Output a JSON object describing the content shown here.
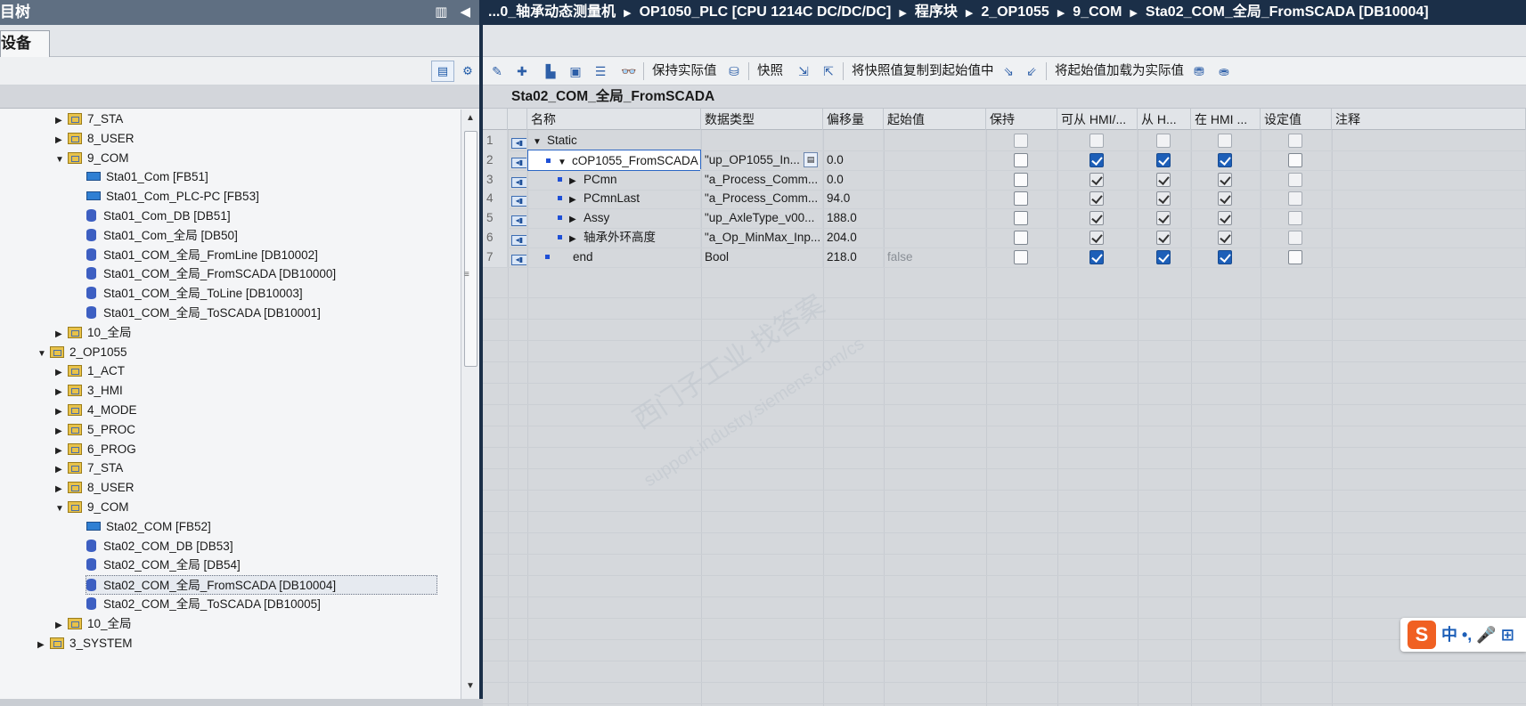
{
  "left_panel": {
    "title": "目树",
    "tab_devices": "设备",
    "tree": [
      {
        "depth": 2,
        "arrow": "right",
        "icon": "folder",
        "label": "7_STA"
      },
      {
        "depth": 2,
        "arrow": "right",
        "icon": "folder",
        "label": "8_USER"
      },
      {
        "depth": 2,
        "arrow": "down",
        "icon": "folder",
        "label": "9_COM"
      },
      {
        "depth": 3,
        "arrow": "",
        "icon": "fb",
        "label": "Sta01_Com [FB51]"
      },
      {
        "depth": 3,
        "arrow": "",
        "icon": "fb",
        "label": "Sta01_Com_PLC-PC [FB53]"
      },
      {
        "depth": 3,
        "arrow": "",
        "icon": "db",
        "label": "Sta01_Com_DB [DB51]"
      },
      {
        "depth": 3,
        "arrow": "",
        "icon": "db",
        "label": "Sta01_Com_全局 [DB50]"
      },
      {
        "depth": 3,
        "arrow": "",
        "icon": "db",
        "label": "Sta01_COM_全局_FromLine [DB10002]"
      },
      {
        "depth": 3,
        "arrow": "",
        "icon": "db",
        "label": "Sta01_COM_全局_FromSCADA [DB10000]"
      },
      {
        "depth": 3,
        "arrow": "",
        "icon": "db",
        "label": "Sta01_COM_全局_ToLine [DB10003]"
      },
      {
        "depth": 3,
        "arrow": "",
        "icon": "db",
        "label": "Sta01_COM_全局_ToSCADA [DB10001]"
      },
      {
        "depth": 2,
        "arrow": "right",
        "icon": "folder",
        "label": "10_全局"
      },
      {
        "depth": 1,
        "arrow": "down",
        "icon": "folder",
        "label": "2_OP1055"
      },
      {
        "depth": 2,
        "arrow": "right",
        "icon": "folder",
        "label": "1_ACT"
      },
      {
        "depth": 2,
        "arrow": "right",
        "icon": "folder",
        "label": "3_HMI"
      },
      {
        "depth": 2,
        "arrow": "right",
        "icon": "folder",
        "label": "4_MODE"
      },
      {
        "depth": 2,
        "arrow": "right",
        "icon": "folder",
        "label": "5_PROC"
      },
      {
        "depth": 2,
        "arrow": "right",
        "icon": "folder",
        "label": "6_PROG"
      },
      {
        "depth": 2,
        "arrow": "right",
        "icon": "folder",
        "label": "7_STA"
      },
      {
        "depth": 2,
        "arrow": "right",
        "icon": "folder",
        "label": "8_USER"
      },
      {
        "depth": 2,
        "arrow": "down",
        "icon": "folder",
        "label": "9_COM"
      },
      {
        "depth": 3,
        "arrow": "",
        "icon": "fb",
        "label": "Sta02_COM [FB52]"
      },
      {
        "depth": 3,
        "arrow": "",
        "icon": "db",
        "label": "Sta02_COM_DB [DB53]"
      },
      {
        "depth": 3,
        "arrow": "",
        "icon": "db",
        "label": "Sta02_COM_全局 [DB54]"
      },
      {
        "depth": 3,
        "arrow": "",
        "icon": "db",
        "label": "Sta02_COM_全局_FromSCADA [DB10004]",
        "selected": true
      },
      {
        "depth": 3,
        "arrow": "",
        "icon": "db",
        "label": "Sta02_COM_全局_ToSCADA [DB10005]"
      },
      {
        "depth": 2,
        "arrow": "right",
        "icon": "folder",
        "label": "10_全局"
      },
      {
        "depth": 1,
        "arrow": "right",
        "icon": "folder",
        "label": "3_SYSTEM"
      }
    ]
  },
  "breadcrumb": [
    "...0_轴承动态测量机",
    "OP1050_PLC [CPU 1214C DC/DC/DC]",
    "程序块",
    "2_OP1055",
    "9_COM",
    "Sta02_COM_全局_FromSCADA [DB10004]"
  ],
  "toolbar": {
    "keep_actual": "保持实际值",
    "snapshot": "快照",
    "copy_snapshot": "将快照值复制到起始值中",
    "load_start": "将起始值加载为实际值"
  },
  "block_title": "Sta02_COM_全局_FromSCADA",
  "columns": [
    "名称",
    "数据类型",
    "偏移量",
    "起始值",
    "保持",
    "可从 HMI/...",
    "从 H...",
    "在 HMI ...",
    "设定值",
    "注释"
  ],
  "rows": [
    {
      "num": "1",
      "indent": 0,
      "arrow": "down",
      "bullet": false,
      "name": "Static",
      "type": "",
      "offset": "",
      "start": "",
      "cb": []
    },
    {
      "num": "2",
      "indent": 1,
      "arrow": "down",
      "bullet": true,
      "name": "cOP1055_FromSCADA",
      "type": "\"up_OP1055_In...",
      "offset": "0.0",
      "start": "",
      "cb": [
        0,
        1,
        1,
        1,
        0
      ],
      "editing": true
    },
    {
      "num": "3",
      "indent": 2,
      "arrow": "right",
      "bullet": true,
      "name": "PCmn",
      "type": "\"a_Process_Comm...",
      "offset": "0.0",
      "start": "",
      "cb": [
        0,
        1,
        1,
        1,
        0
      ],
      "grey": true
    },
    {
      "num": "4",
      "indent": 2,
      "arrow": "right",
      "bullet": true,
      "name": "PCmnLast",
      "type": "\"a_Process_Comm...",
      "offset": "94.0",
      "start": "",
      "cb": [
        0,
        1,
        1,
        1,
        0
      ],
      "grey": true
    },
    {
      "num": "5",
      "indent": 2,
      "arrow": "right",
      "bullet": true,
      "name": "Assy",
      "type": "\"up_AxleType_v00...",
      "offset": "188.0",
      "start": "",
      "cb": [
        0,
        1,
        1,
        1,
        0
      ],
      "grey": true
    },
    {
      "num": "6",
      "indent": 2,
      "arrow": "right",
      "bullet": true,
      "name": "轴承外环高度",
      "type": "\"a_Op_MinMax_Inp...",
      "offset": "204.0",
      "start": "",
      "cb": [
        0,
        1,
        1,
        1,
        0
      ],
      "grey": true
    },
    {
      "num": "7",
      "indent": 1,
      "arrow": "",
      "bullet": true,
      "name": "end",
      "type": "Bool",
      "offset": "218.0",
      "start": "false",
      "cb": [
        0,
        1,
        1,
        1,
        0
      ]
    }
  ],
  "watermark": "西门子工业  找答案",
  "watermark_url": "support.industry.siemens.com/cs",
  "ime": "中 •, 🎤 ⊞"
}
